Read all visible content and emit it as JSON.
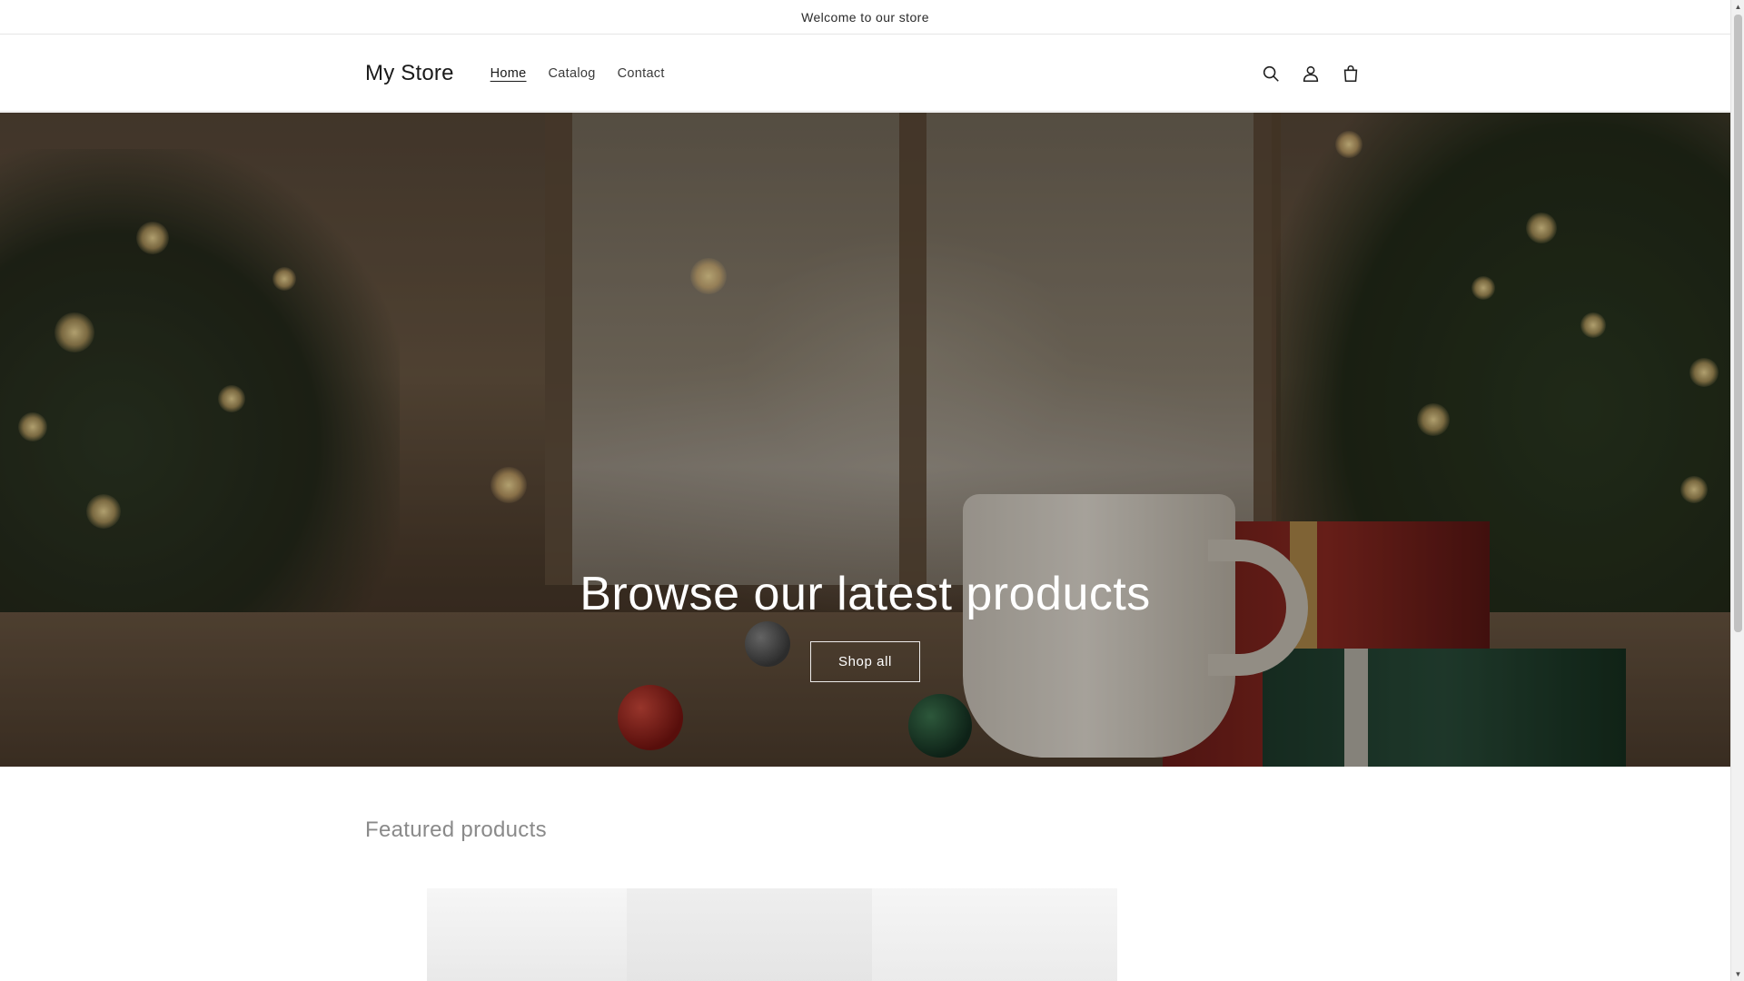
{
  "announcement": {
    "text": "Welcome to our store"
  },
  "header": {
    "logo": "My Store",
    "nav": [
      {
        "label": "Home",
        "active": true
      },
      {
        "label": "Catalog",
        "active": false
      },
      {
        "label": "Contact",
        "active": false
      }
    ],
    "icons": [
      "search-icon",
      "account-icon",
      "cart-icon"
    ]
  },
  "hero": {
    "title": "Browse our latest products",
    "button_label": "Shop all"
  },
  "featured": {
    "title": "Featured products"
  },
  "colors": {
    "text": "#121212",
    "muted_heading": "#8a8a8a",
    "border": "#e6e6e6",
    "hero_text": "#ffffff"
  }
}
